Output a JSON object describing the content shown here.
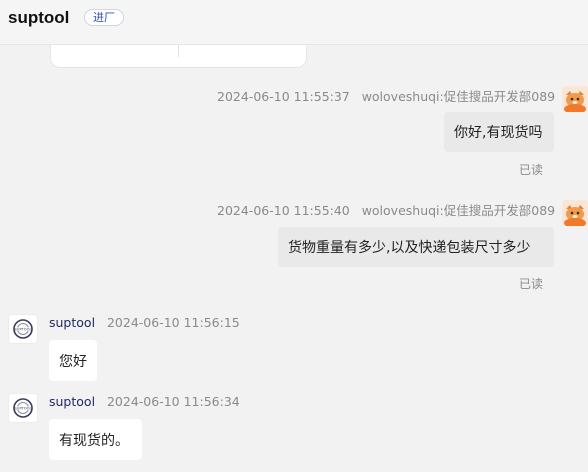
{
  "header": {
    "brand": "suptool",
    "enter_badge": "进厂"
  },
  "messages": [
    {
      "side": "right",
      "timestamp": "2024-06-10 11:55:37",
      "sender": "woloveshuqi:促佳搜品开发部089",
      "text": "你好,有现货吗",
      "status": "已读"
    },
    {
      "side": "right",
      "timestamp": "2024-06-10 11:55:40",
      "sender": "woloveshuqi:促佳搜品开发部089",
      "text": "货物重量有多少,以及快递包装尺寸多少",
      "status": "已读"
    },
    {
      "side": "left",
      "sender": "suptool",
      "timestamp": "2024-06-10 11:56:15",
      "text": "您好"
    },
    {
      "side": "left",
      "sender": "suptool",
      "timestamp": "2024-06-10 11:56:34",
      "text": "有现货的。"
    }
  ],
  "colors": {
    "background": "#f2f2f2",
    "outgoing_bubble": "#e9e9e9",
    "incoming_bubble": "#ffffff",
    "accent_badge": "#2a52be",
    "seller_name": "#1f2a66"
  }
}
